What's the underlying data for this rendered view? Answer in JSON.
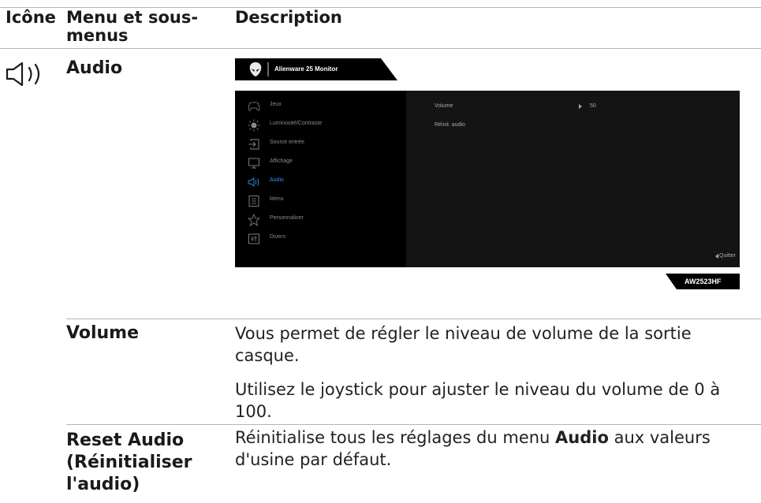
{
  "header": {
    "col_icon": "Icône",
    "col_menu_line1": "Menu et sous-",
    "col_menu_line2": "menus",
    "col_desc": "Description"
  },
  "section": {
    "title": "Audio",
    "icon": "speaker-icon"
  },
  "osd": {
    "brand_title": "Alienware 25 Monitor",
    "menu_items": [
      {
        "label": "Jeux",
        "icon": "gamepad-icon"
      },
      {
        "label": "Luminosité/Contraste",
        "icon": "brightness-icon"
      },
      {
        "label": "Source entrée",
        "icon": "input-source-icon"
      },
      {
        "label": "Affichage",
        "icon": "display-icon"
      },
      {
        "label": "Audio",
        "icon": "speaker-icon",
        "active": true
      },
      {
        "label": "Menu",
        "icon": "menu-list-icon"
      },
      {
        "label": "Personnaliser",
        "icon": "star-icon"
      },
      {
        "label": "Divers",
        "icon": "others-icon"
      }
    ],
    "submenu": {
      "volume_label": "Volume",
      "volume_value": "50",
      "reset_label": "Réinit. audio"
    },
    "exit_label": "Quitter",
    "model": "AW2523HF",
    "colors": {
      "active": "#3b8ee8",
      "panel": "#000000",
      "panel_right": "#141414"
    }
  },
  "rows": [
    {
      "label": "Volume",
      "paragraphs": [
        "Vous permet de régler le niveau de volume de la sortie casque.",
        "Utilisez le joystick pour ajuster le niveau du volume de 0 à 100."
      ]
    },
    {
      "label_lines": [
        "Reset Audio",
        "(Réinitialiser",
        "l'audio)"
      ],
      "desc_before": "Réinitialise tous les réglages du menu ",
      "desc_bold": "Audio",
      "desc_after": " aux valeurs d'usine par défaut."
    }
  ]
}
